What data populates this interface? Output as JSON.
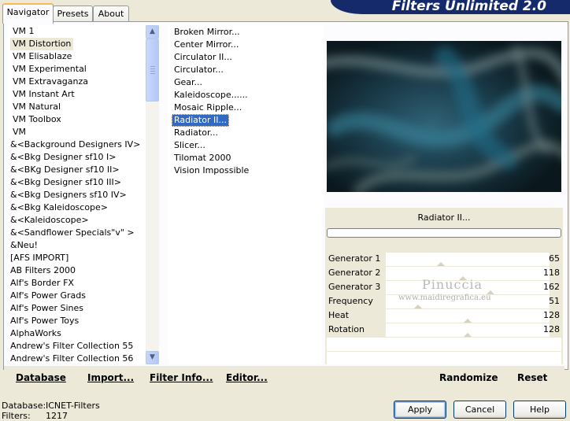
{
  "banner": {
    "title": "Filters Unlimited 2.0"
  },
  "tabs": [
    {
      "label": "Navigator"
    },
    {
      "label": "Presets"
    },
    {
      "label": "About"
    }
  ],
  "categories": {
    "items": [
      "VM 1",
      "VM Distortion",
      "VM Elisablaze",
      "VM Experimental",
      "VM Extravaganza",
      "VM Instant Art",
      "VM Natural",
      "VM Toolbox",
      "VM",
      "&<Background Designers IV>",
      "&<Bkg Designer sf10 I>",
      "&<BKg Designer sf10 II>",
      "&<Bkg Designer sf10 III>",
      "&<Bkg Designers sf10 IV>",
      "&<Bkg Kaleidoscope>",
      "&<Kaleidoscope>",
      "&<Sandflower Specials\"v\" >",
      "&Neu!",
      "[AFS IMPORT]",
      "AB Filters 2000",
      "Alf's Border FX",
      "Alf's Power Grads",
      "Alf's Power Sines",
      "Alf's Power Toys",
      "AlphaWorks",
      "Andrew's Filter Collection 55",
      "Andrew's Filter Collection 56"
    ],
    "selected": "VM Distortion"
  },
  "filters": {
    "items": [
      "Broken Mirror...",
      "Center Mirror...",
      "Circulator II...",
      "Circulator...",
      "Gear...",
      "Kaleidoscope......",
      "Mosaic Ripple...",
      "Radiator II...",
      "Radiator...",
      "Slicer...",
      "Tilomat 2000",
      "Vision Impossible"
    ],
    "selected": "Radiator II..."
  },
  "preview": {
    "filter_name": "Radiator II..."
  },
  "parameters": [
    {
      "label": "Generator 1",
      "value": "65"
    },
    {
      "label": "Generator 2",
      "value": "118"
    },
    {
      "label": "Generator 3",
      "value": "162"
    },
    {
      "label": "Frequency",
      "value": "51"
    },
    {
      "label": "Heat",
      "value": "128"
    },
    {
      "label": "Rotation",
      "value": "128"
    }
  ],
  "watermark": {
    "name": "Pinuccia",
    "site": "www.maidiregrafica.eu"
  },
  "bottom_actions": {
    "database": "Database",
    "import": "Import...",
    "filter_info": "Filter Info...",
    "editor": "Editor...",
    "randomize": "Randomize",
    "reset": "Reset"
  },
  "status": {
    "database_label": "Database:",
    "database_value": "ICNET-Filters",
    "filters_label": "Filters:",
    "filters_value": "1217"
  },
  "buttons": {
    "apply": "Apply",
    "cancel": "Cancel",
    "help": "Help"
  }
}
